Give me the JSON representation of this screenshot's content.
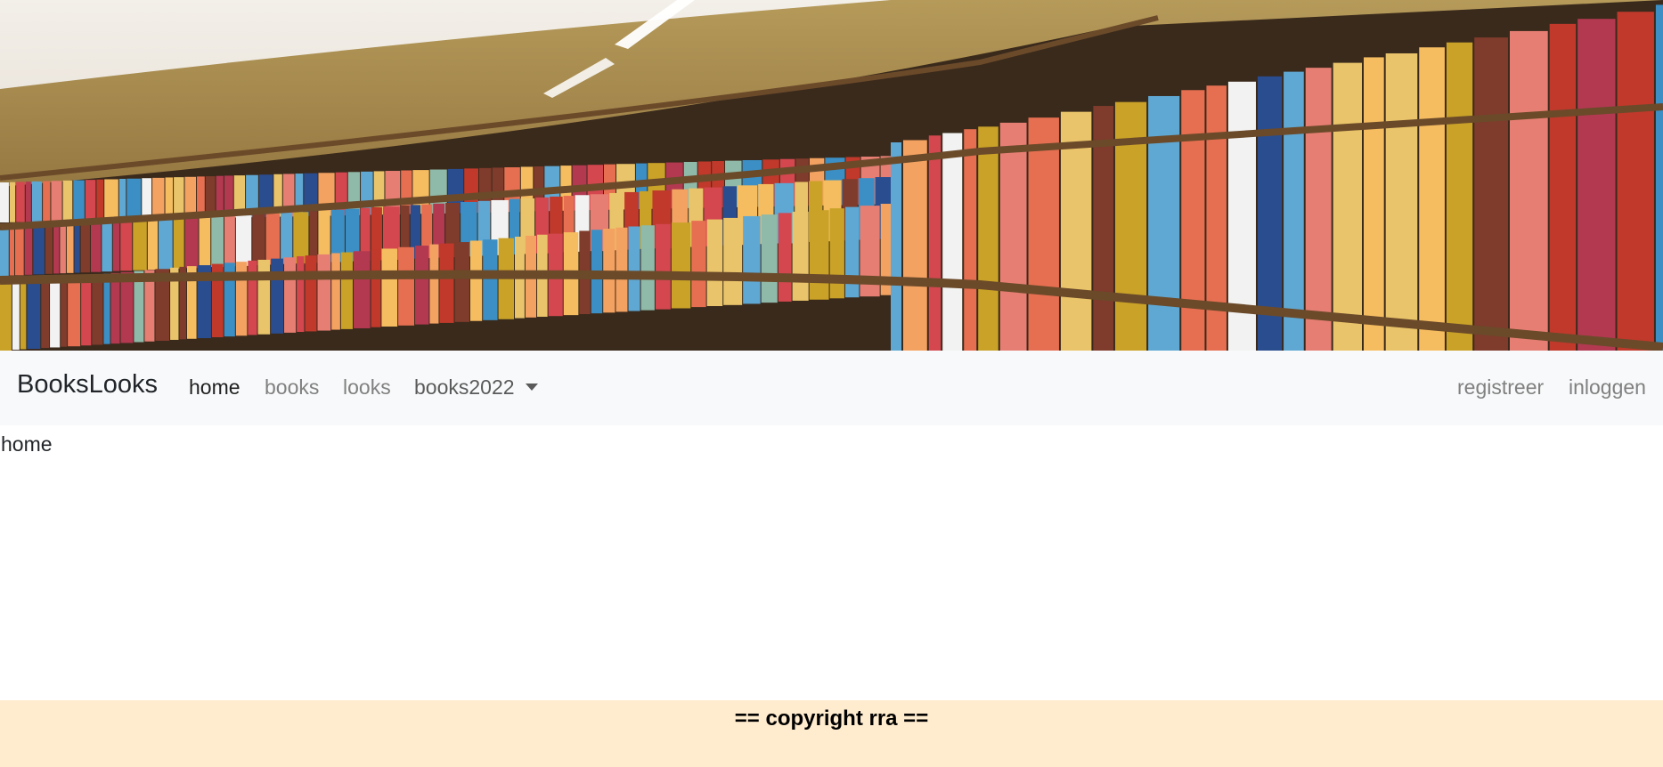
{
  "banner": {
    "alt": "library bookshelves"
  },
  "navbar": {
    "brand": "BooksLooks",
    "links": [
      {
        "label": "home",
        "active": true
      },
      {
        "label": "books",
        "active": false
      },
      {
        "label": "looks",
        "active": false
      },
      {
        "label": "books2022",
        "dropdown": true
      }
    ],
    "right_links": [
      {
        "label": "registreer"
      },
      {
        "label": "inloggen"
      }
    ]
  },
  "main": {
    "text": "home"
  },
  "footer": {
    "text": "== copyright rra =="
  },
  "colors": {
    "navbar_bg": "#f8f9fa",
    "footer_bg": "#ffebcd",
    "active_link": "#1f1f1f",
    "inactive_link": "#808080"
  }
}
